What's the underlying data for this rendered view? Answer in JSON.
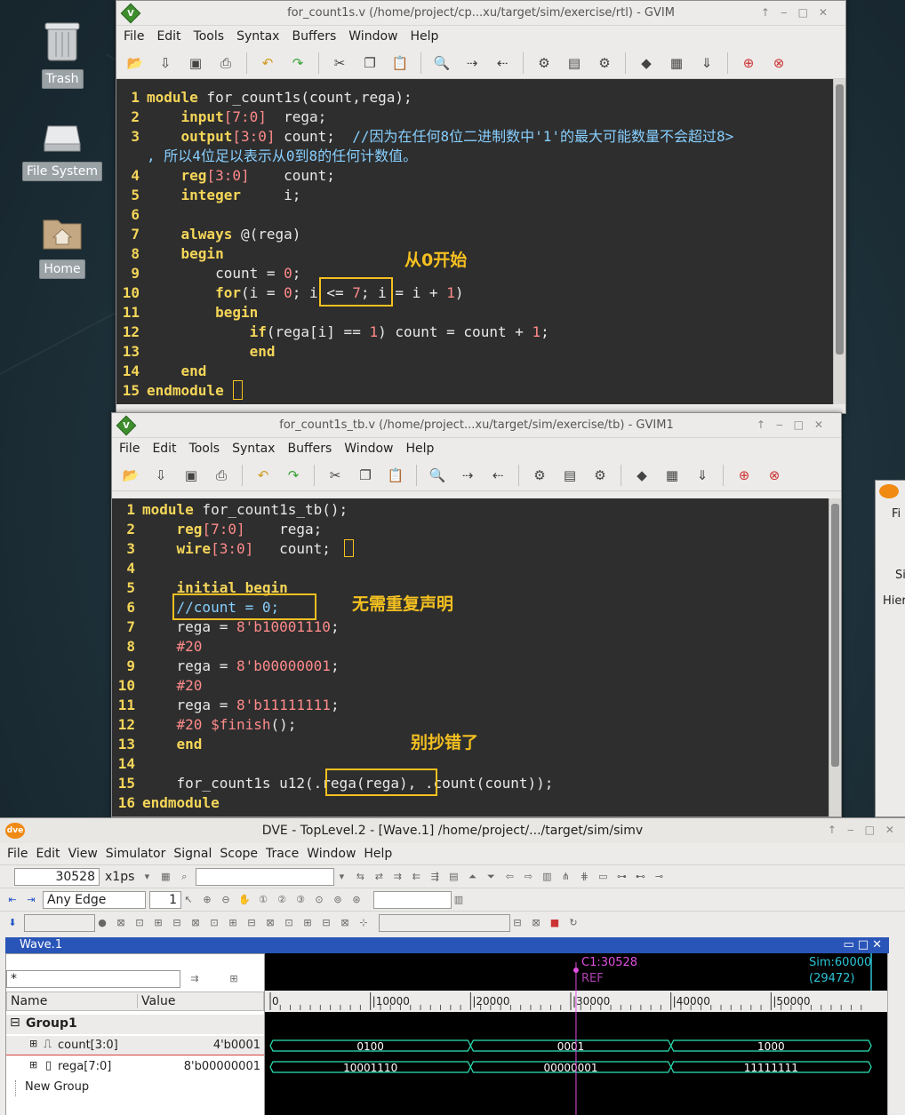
{
  "desktop": {
    "icons": [
      {
        "label": "Trash"
      },
      {
        "label": "File System"
      },
      {
        "label": "Home"
      }
    ]
  },
  "gvim1": {
    "title": "for_count1s.v (/home/project/cp...xu/target/sim/exercise/rtl) - GVIM",
    "menu": [
      "File",
      "Edit",
      "Tools",
      "Syntax",
      "Buffers",
      "Window",
      "Help"
    ],
    "lines": [
      {
        "no": "1",
        "parts": [
          [
            "kw",
            "module"
          ],
          [
            "t",
            " for_count1s(count,rega);"
          ]
        ]
      },
      {
        "no": "2",
        "parts": [
          [
            "t",
            "    "
          ],
          [
            "kw",
            "input"
          ],
          [
            "num",
            "[7:0]"
          ],
          [
            "t",
            "  rega;"
          ]
        ]
      },
      {
        "no": "3",
        "parts": [
          [
            "t",
            "    "
          ],
          [
            "kw",
            "output"
          ],
          [
            "num",
            "[3:0]"
          ],
          [
            "t",
            " count;  "
          ],
          [
            "cmt",
            "//因为在任何8位二进制数中'1'的最大可能数量不会超过8>"
          ]
        ]
      },
      {
        "no": "",
        "parts": [
          [
            "cmt",
            ", 所以4位足以表示从0到8的任何计数值。"
          ]
        ]
      },
      {
        "no": "4",
        "parts": [
          [
            "t",
            "    "
          ],
          [
            "kw",
            "reg"
          ],
          [
            "num",
            "[3:0]"
          ],
          [
            "t",
            "    count;"
          ]
        ]
      },
      {
        "no": "5",
        "parts": [
          [
            "t",
            "    "
          ],
          [
            "kw",
            "integer"
          ],
          [
            "t",
            "     i;"
          ]
        ]
      },
      {
        "no": "6",
        "parts": []
      },
      {
        "no": "7",
        "parts": [
          [
            "t",
            "    "
          ],
          [
            "kw",
            "always"
          ],
          [
            "t",
            " @(rega)"
          ]
        ]
      },
      {
        "no": "8",
        "parts": [
          [
            "t",
            "    "
          ],
          [
            "kw",
            "begin"
          ]
        ]
      },
      {
        "no": "9",
        "parts": [
          [
            "t",
            "        count = "
          ],
          [
            "num",
            "0"
          ],
          [
            "t",
            ";"
          ]
        ]
      },
      {
        "no": "10",
        "parts": [
          [
            "t",
            "        "
          ],
          [
            "kw",
            "for"
          ],
          [
            "t",
            "(i = "
          ],
          [
            "num",
            "0"
          ],
          [
            "t",
            "; i <= "
          ],
          [
            "num",
            "7"
          ],
          [
            "t",
            "; i = i + "
          ],
          [
            "num",
            "1"
          ],
          [
            "t",
            ")"
          ]
        ]
      },
      {
        "no": "11",
        "parts": [
          [
            "t",
            "        "
          ],
          [
            "kw",
            "begin"
          ]
        ]
      },
      {
        "no": "12",
        "parts": [
          [
            "t",
            "            "
          ],
          [
            "kw",
            "if"
          ],
          [
            "t",
            "(rega[i] == "
          ],
          [
            "num",
            "1"
          ],
          [
            "t",
            ") count = count + "
          ],
          [
            "num",
            "1"
          ],
          [
            "t",
            ";"
          ]
        ]
      },
      {
        "no": "13",
        "parts": [
          [
            "t",
            "            "
          ],
          [
            "kw",
            "end"
          ]
        ]
      },
      {
        "no": "14",
        "parts": [
          [
            "t",
            "    "
          ],
          [
            "kw",
            "end"
          ]
        ]
      },
      {
        "no": "15",
        "parts": [
          [
            "kw",
            "endmodule"
          ]
        ]
      }
    ],
    "annotation": "从0开始"
  },
  "gvim2": {
    "title": "for_count1s_tb.v (/home/project...xu/target/sim/exercise/tb) - GVIM1",
    "menu": [
      "File",
      "Edit",
      "Tools",
      "Syntax",
      "Buffers",
      "Window",
      "Help"
    ],
    "lines": [
      {
        "no": "1",
        "parts": [
          [
            "kw",
            "module"
          ],
          [
            "t",
            " for_count1s_tb();"
          ]
        ]
      },
      {
        "no": "2",
        "parts": [
          [
            "t",
            "    "
          ],
          [
            "kw",
            "reg"
          ],
          [
            "num",
            "[7:0]"
          ],
          [
            "t",
            "    rega;"
          ]
        ]
      },
      {
        "no": "3",
        "parts": [
          [
            "t",
            "    "
          ],
          [
            "kw",
            "wire"
          ],
          [
            "num",
            "[3:0]"
          ],
          [
            "t",
            "   count;"
          ]
        ]
      },
      {
        "no": "4",
        "parts": []
      },
      {
        "no": "5",
        "parts": [
          [
            "t",
            "    "
          ],
          [
            "kw",
            "initial begin"
          ]
        ]
      },
      {
        "no": "6",
        "parts": [
          [
            "t",
            "    "
          ],
          [
            "cmt",
            "//count = 0;"
          ]
        ]
      },
      {
        "no": "7",
        "parts": [
          [
            "t",
            "    rega = "
          ],
          [
            "num",
            "8'b10001110"
          ],
          [
            "t",
            ";"
          ]
        ]
      },
      {
        "no": "8",
        "parts": [
          [
            "t",
            "    "
          ],
          [
            "num",
            "#20"
          ]
        ]
      },
      {
        "no": "9",
        "parts": [
          [
            "t",
            "    rega = "
          ],
          [
            "num",
            "8'b00000001"
          ],
          [
            "t",
            ";"
          ]
        ]
      },
      {
        "no": "10",
        "parts": [
          [
            "t",
            "    "
          ],
          [
            "num",
            "#20"
          ]
        ]
      },
      {
        "no": "11",
        "parts": [
          [
            "t",
            "    rega = "
          ],
          [
            "num",
            "8'b11111111"
          ],
          [
            "t",
            ";"
          ]
        ]
      },
      {
        "no": "12",
        "parts": [
          [
            "t",
            "    "
          ],
          [
            "num",
            "#20 $finish"
          ],
          [
            "t",
            "();"
          ]
        ]
      },
      {
        "no": "13",
        "parts": [
          [
            "t",
            "    "
          ],
          [
            "kw",
            "end"
          ]
        ]
      },
      {
        "no": "14",
        "parts": []
      },
      {
        "no": "15",
        "parts": [
          [
            "t",
            "    for_count1s u12(.rega(rega), .count(count));"
          ]
        ]
      },
      {
        "no": "16",
        "parts": [
          [
            "kw",
            "endmodule"
          ]
        ]
      }
    ],
    "annotation1": "无需重复声明",
    "annotation2": "别抄错了"
  },
  "dve": {
    "title": "DVE - TopLevel.2 - [Wave.1]  /home/project/.../target/sim/simv",
    "menu": [
      "File",
      "Edit",
      "View",
      "Simulator",
      "Signal",
      "Scope",
      "Trace",
      "Window",
      "Help"
    ],
    "time_value": "30528",
    "time_unit": "x1ps",
    "edge": "Any Edge",
    "count_field": "1",
    "wave_tab": "Wave.1",
    "filter": "*",
    "col_name": "Name",
    "col_value": "Value",
    "group": "Group1",
    "signals": [
      {
        "name": "count[3:0]",
        "value": "4'b0001"
      },
      {
        "name": "rega[7:0]",
        "value": "8'b00000001"
      }
    ],
    "new_group": "New Group",
    "cursor_label": "C1:30528",
    "ref_label": "REF",
    "sim_label": "Sim:60000",
    "sim_sub": "(29472)",
    "ticks": [
      "0",
      "10000",
      "20000",
      "30000",
      "40000",
      "50000"
    ],
    "count_wave": [
      "0100",
      "0001",
      "1000"
    ],
    "rega_wave": [
      "10001110",
      "00000001",
      "11111111"
    ]
  },
  "side_window": {
    "labels": [
      "Fi",
      "Si",
      "Hier"
    ]
  }
}
